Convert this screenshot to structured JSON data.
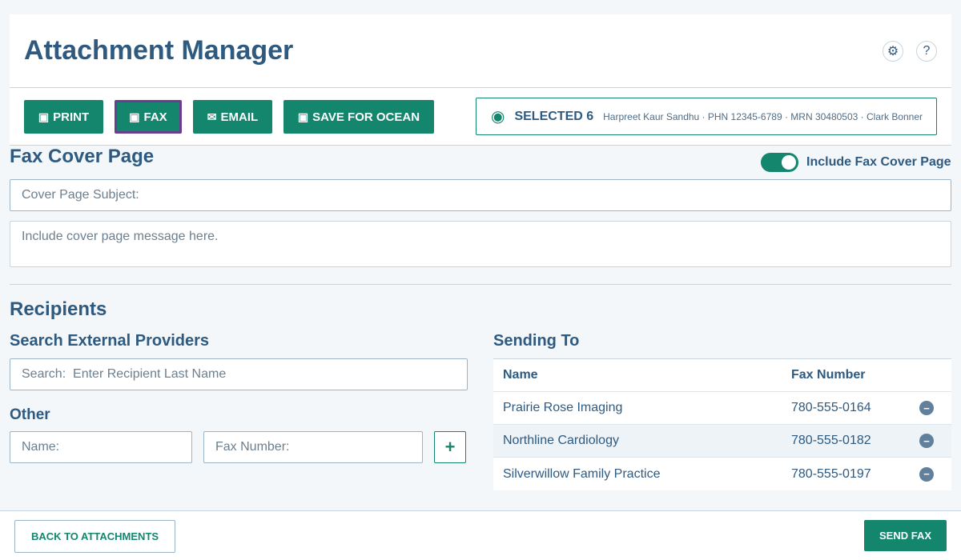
{
  "app": {
    "title": "Attachment Manager"
  },
  "header_icons": {
    "settings": "⚙",
    "help": "?"
  },
  "toolbar": {
    "print_glyph": "▣",
    "print_label": "PRINT",
    "fax_glyph": "▣",
    "fax_label": "FAX",
    "email_glyph": "✉",
    "email_label": "EMAIL",
    "ocean_glyph": "▣",
    "ocean_label": "SAVE FOR OCEAN"
  },
  "selection": {
    "icon": "◉",
    "label": "SELECTED 6",
    "info": "Harpreet Kaur Sandhu · PHN 12345-6789 · MRN 30480503 · Clark Bonner"
  },
  "cover": {
    "title": "Fax Cover Page",
    "toggle_label": "Include Fax Cover Page",
    "toggle_on": true,
    "subject_placeholder": "Cover Page Subject:",
    "message_placeholder": "Include cover page message here."
  },
  "recipients": {
    "title": "Recipients",
    "search_title": "Search External Providers",
    "search_placeholder": "Search:  Enter Recipient Last Name",
    "other_title": "Other",
    "name_placeholder": "Name:",
    "fax_placeholder": "Fax Number:",
    "add_label": "+"
  },
  "sending_to": {
    "title": "Sending To",
    "columns": {
      "name": "Name",
      "fax": "Fax Number"
    },
    "remove_glyph": "−",
    "rows": [
      {
        "name": "Prairie Rose Imaging",
        "fax": "780-555-0164"
      },
      {
        "name": "Northline Cardiology",
        "fax": "780-555-0182"
      },
      {
        "name": "Silverwillow Family Practice",
        "fax": "780-555-0197"
      }
    ]
  },
  "footer": {
    "back_label": "BACK TO ATTACHMENTS",
    "send_label": "SEND FAX"
  },
  "colors": {
    "accent": "#14866e",
    "heading": "#2e5a80",
    "active_outline": "#6a3d8f",
    "background": "#f3f7fa"
  }
}
